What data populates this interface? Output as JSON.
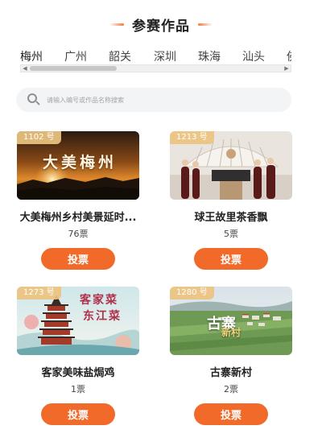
{
  "header": {
    "title": "参赛作品"
  },
  "tabs": [
    {
      "label": "梅州",
      "active": true
    },
    {
      "label": "广州",
      "active": false
    },
    {
      "label": "韶关",
      "active": false
    },
    {
      "label": "深圳",
      "active": false
    },
    {
      "label": "珠海",
      "active": false
    },
    {
      "label": "汕头",
      "active": false
    },
    {
      "label": "佛",
      "active": false
    }
  ],
  "search": {
    "placeholder": "请输入编号或作品名称搜索"
  },
  "entries": [
    {
      "number": "1102 号",
      "title": "大美梅州乡村美景延时...",
      "votes": "76票",
      "vote_label": "投票",
      "art_text": "大美梅州"
    },
    {
      "number": "1213 号",
      "title": "球王故里茶香飘",
      "votes": "5票",
      "vote_label": "投票",
      "art_text": ""
    },
    {
      "number": "1273 号",
      "title": "客家美味盐焗鸡",
      "votes": "1票",
      "vote_label": "投票",
      "art_text": "客家菜",
      "art_text_2": "东江菜"
    },
    {
      "number": "1280 号",
      "title": "古寨新村",
      "votes": "2票",
      "vote_label": "投票",
      "art_text": "古寨",
      "art_text_2": "新村"
    }
  ],
  "colors": {
    "accent": "#f26a2a",
    "badge": "#ecc480",
    "search_bg": "#f3f4f6"
  }
}
